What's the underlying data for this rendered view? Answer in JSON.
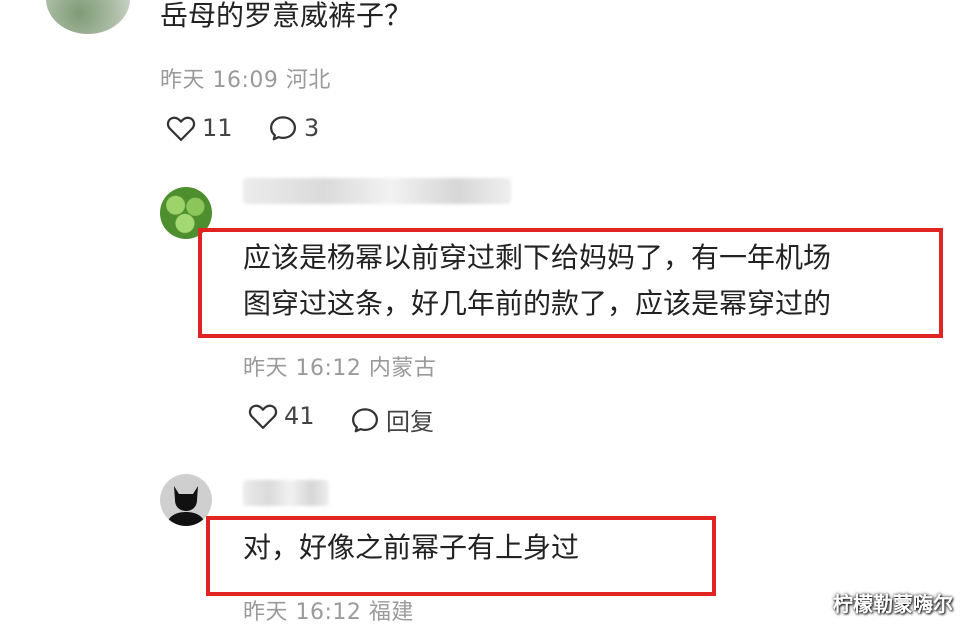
{
  "comments": [
    {
      "text": "岳母的罗意威裤子？",
      "meta": "昨天 16:09 河北",
      "like_count": "11",
      "reply_count": "3"
    },
    {
      "text_line1": "应该是杨幂以前穿过剩下给妈妈了，有一年机场",
      "text_line2": "图穿过这条，好几年前的款了，应该是幂穿过的",
      "meta": "昨天 16:12 内蒙古",
      "like_count": "41",
      "reply_label": "回复"
    },
    {
      "text": "对，好像之前幂子有上身过",
      "meta": "昨天 16:12 福建"
    }
  ],
  "watermark": "柠檬勒蒙嗨尔",
  "icons": {
    "like": "heart-icon",
    "reply": "comment-bubble-icon"
  },
  "colors": {
    "highlight_border": "#e02323",
    "meta_text": "#9a9a9a"
  }
}
